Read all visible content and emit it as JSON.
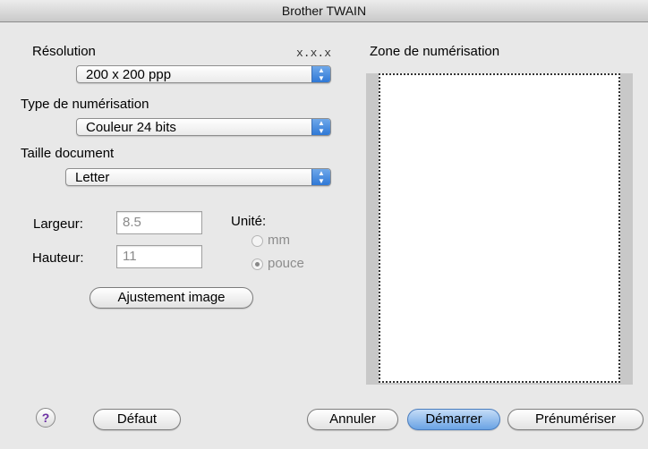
{
  "window": {
    "title": "Brother TWAIN"
  },
  "resolution": {
    "label": "Résolution",
    "value": "200 x 200 ppp",
    "version": "x.x.x"
  },
  "scan_type": {
    "label": "Type de numérisation",
    "value": "Couleur 24 bits"
  },
  "document_size": {
    "label": "Taille document",
    "value": "Letter"
  },
  "dimensions": {
    "width_label": "Largeur:",
    "width_value": "8.5",
    "height_label": "Hauteur:",
    "height_value": "11"
  },
  "unit": {
    "label": "Unité:",
    "options": [
      "mm",
      "pouce"
    ],
    "selected": "pouce"
  },
  "adjust_button": "Ajustement image",
  "scan_zone": {
    "label": "Zone de numérisation"
  },
  "footer": {
    "help": "?",
    "default_button": "Défaut",
    "cancel_button": "Annuler",
    "start_button": "Démarrer",
    "prescan_button": "Prénumériser"
  }
}
